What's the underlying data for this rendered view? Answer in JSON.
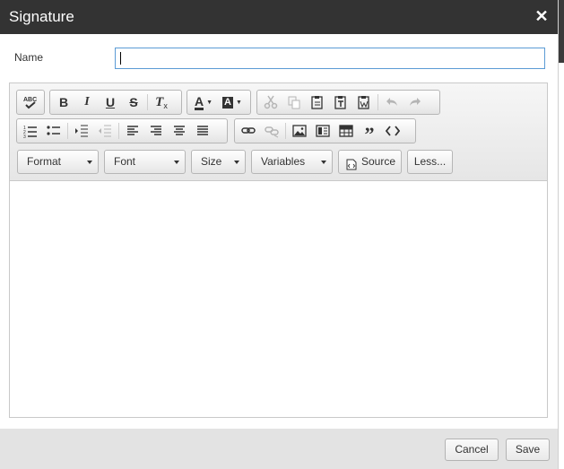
{
  "dialog": {
    "title": "Signature",
    "close_glyph": "✕"
  },
  "form": {
    "name_label": "Name",
    "name_value": "",
    "name_placeholder": ""
  },
  "toolbar": {
    "row1": {
      "spellcheck_label": "ABC",
      "bold": "B",
      "italic": "I",
      "underline": "U",
      "strike": "S",
      "remove_format": "T",
      "text_color": "A",
      "bg_color": "A"
    },
    "combos": {
      "format": "Format",
      "font": "Font",
      "size": "Size",
      "variables": "Variables"
    },
    "source_label": "Source",
    "less_label": "Less...",
    "icons": [
      "spellcheck-icon",
      "bold-icon",
      "italic-icon",
      "underline-icon",
      "strikethrough-icon",
      "remove-format-icon",
      "text-color-icon",
      "background-color-icon",
      "cut-icon",
      "copy-icon",
      "paste-icon",
      "paste-text-icon",
      "paste-word-icon",
      "undo-icon",
      "redo-icon",
      "numbered-list-icon",
      "bulleted-list-icon",
      "increase-indent-icon",
      "decrease-indent-icon",
      "align-left-icon",
      "align-right-icon",
      "align-center-icon",
      "justify-icon",
      "link-icon",
      "unlink-icon",
      "image-icon",
      "flash-icon",
      "table-icon",
      "blockquote-icon",
      "code-icon",
      "source-icon"
    ]
  },
  "footer": {
    "cancel_label": "Cancel",
    "save_label": "Save"
  },
  "colors": {
    "titlebar": "#333333",
    "input_border": "#5b9bd5",
    "footer": "#e3e3e3"
  }
}
